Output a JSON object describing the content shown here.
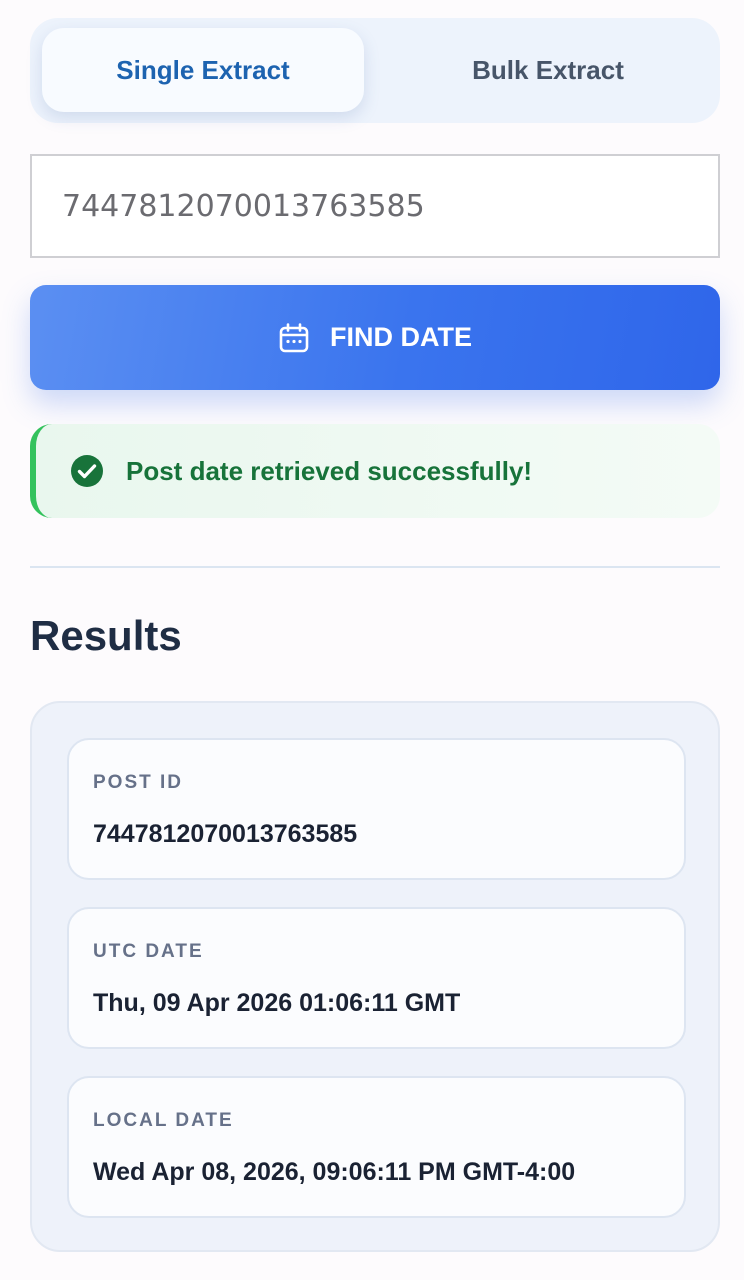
{
  "tabs": {
    "single": "Single Extract",
    "bulk": "Bulk Extract",
    "active": "single"
  },
  "input": {
    "value": "7447812070013763585"
  },
  "find_button": {
    "label": "FIND DATE",
    "icon": "calendar-icon"
  },
  "alert": {
    "icon": "check-circle-icon",
    "message": "Post date retrieved successfully!"
  },
  "results": {
    "title": "Results",
    "cards": [
      {
        "label": "POST ID",
        "value": "7447812070013763585"
      },
      {
        "label": "UTC DATE",
        "value": "Thu, 09 Apr 2026 01:06:11 GMT"
      },
      {
        "label": "LOCAL DATE",
        "value": "Wed Apr 08, 2026, 09:06:11 PM GMT-4:00"
      }
    ]
  },
  "colors": {
    "primary": "#3a74ee",
    "active_tab_text": "#1d63b0",
    "success": "#17733a",
    "success_border": "#34c25d",
    "heading": "#1f2d44"
  }
}
